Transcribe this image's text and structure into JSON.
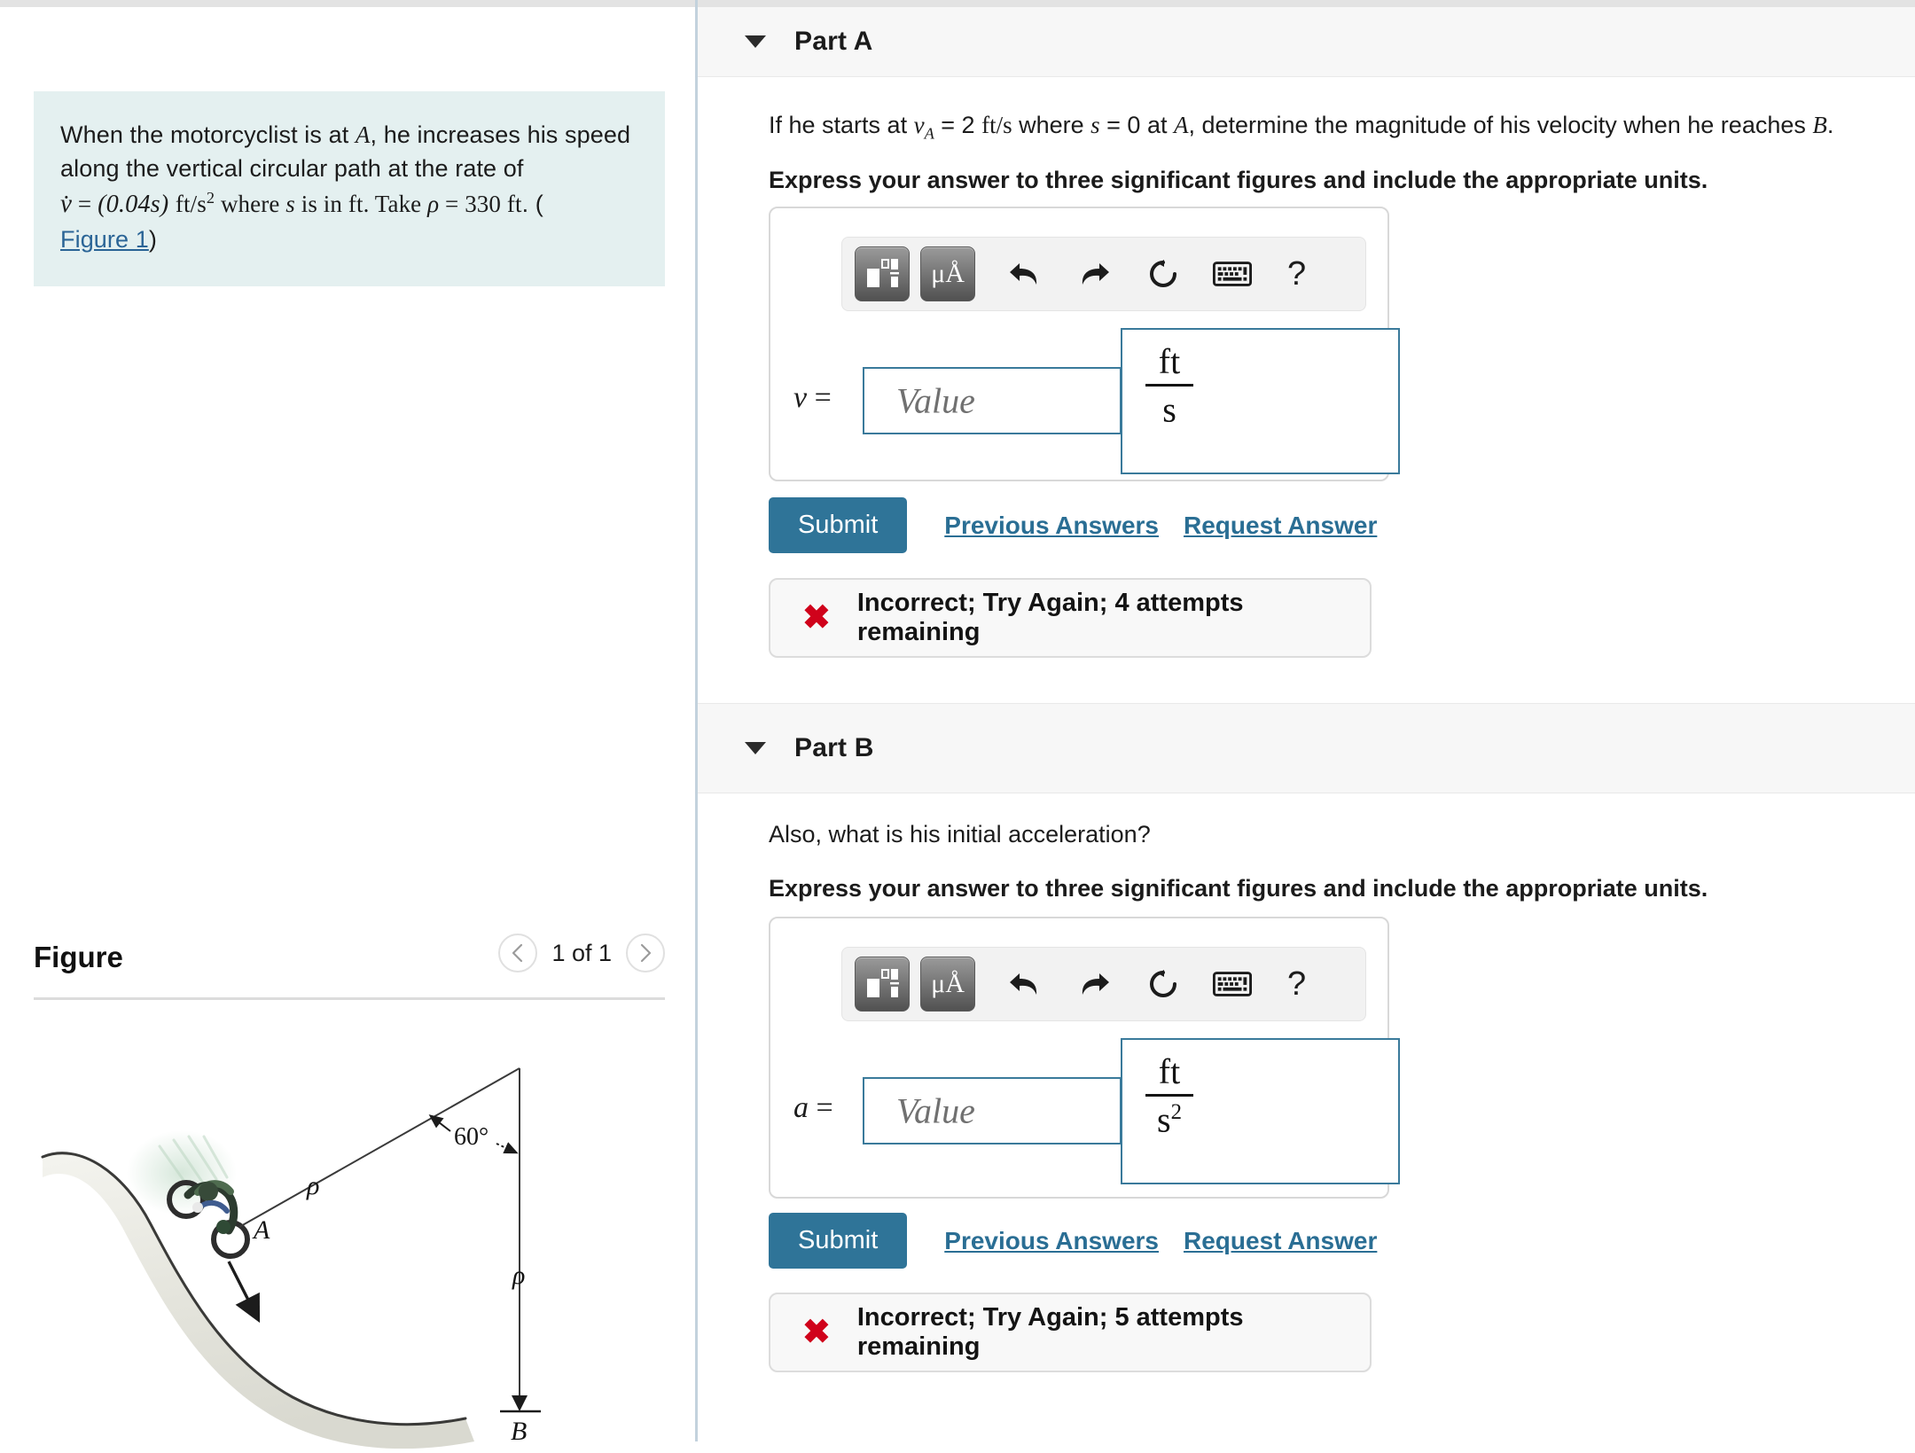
{
  "problem": {
    "line1_a": "When the motorcyclist is at ",
    "var_A": "A",
    "line1_b": ", he increases his speed",
    "line2": "along the vertical circular path at the rate of",
    "eq_vdot": "v̇",
    "eq_equals": " = ",
    "eq_expr": "(0.04s)",
    "eq_units_num": "ft",
    "eq_units_den": "s",
    "eq_units_exp": "2",
    "eq_where": " where ",
    "eq_s": "s",
    "eq_isin": " is in ",
    "eq_ft": "ft",
    "eq_take": ". Take ",
    "eq_rho": "ρ",
    "eq_rho_val": " = 330 ",
    "eq_ft2": "ft",
    "eq_paren": ". (",
    "figure_link": "Figure 1",
    "close_paren": ")"
  },
  "figure": {
    "title": "Figure",
    "prev_icon": "chevron-left-icon",
    "next_icon": "chevron-right-icon",
    "counter": "1 of 1",
    "labels": {
      "point_a": "A",
      "point_b": "B",
      "rho_upper": "ρ",
      "rho_lower": "ρ",
      "angle": "60°"
    }
  },
  "toolbar": {
    "template_button": "template-icon",
    "units_button": "μÅ",
    "undo": "undo-icon",
    "redo": "redo-icon",
    "reset": "reset-icon",
    "keyboard": "keyboard-icon",
    "help": "?"
  },
  "parts": [
    {
      "id": "part-a",
      "label": "Part A",
      "caret": "caret-down-icon",
      "question": {
        "pre": "If he starts at ",
        "v_sym": "v",
        "v_sub": "A",
        "mid1": " = 2 ",
        "units": "ft/s",
        "mid2": " where ",
        "s_sym": "s",
        "mid3": " = 0 at ",
        "a_sym": "A",
        "post": ", determine the magnitude of his velocity when he reaches ",
        "b_sym": "B",
        "end": "."
      },
      "instruction": "Express your answer to three significant figures and include the appropriate units.",
      "answer": {
        "variable": "v",
        "equals": "=",
        "placeholder": "Value",
        "units_numerator": "ft",
        "units_denominator": "s",
        "units_exponent": ""
      },
      "submit_label": "Submit",
      "previous_answers_label": "Previous Answers",
      "request_answer_label": "Request Answer",
      "feedback": {
        "icon": "x-mark-icon",
        "text": "Incorrect; Try Again; 4 attempts remaining"
      }
    },
    {
      "id": "part-b",
      "label": "Part B",
      "caret": "caret-down-icon",
      "question": {
        "plain": "Also, what is his initial acceleration?"
      },
      "instruction": "Express your answer to three significant figures and include the appropriate units.",
      "answer": {
        "variable": "a",
        "equals": "=",
        "placeholder": "Value",
        "units_numerator": "ft",
        "units_denominator": "s",
        "units_exponent": "2"
      },
      "submit_label": "Submit",
      "previous_answers_label": "Previous Answers",
      "request_answer_label": "Request Answer",
      "feedback": {
        "icon": "x-mark-icon",
        "text": "Incorrect; Try Again; 5 attempts remaining"
      }
    }
  ],
  "colors": {
    "accent_blue": "#2f7498",
    "link_blue": "#2a6e94",
    "problem_bg": "#e4f0f0",
    "error_red": "#d0021b",
    "input_border": "#3a7a9b",
    "panel_bg": "#f7f7f7"
  }
}
